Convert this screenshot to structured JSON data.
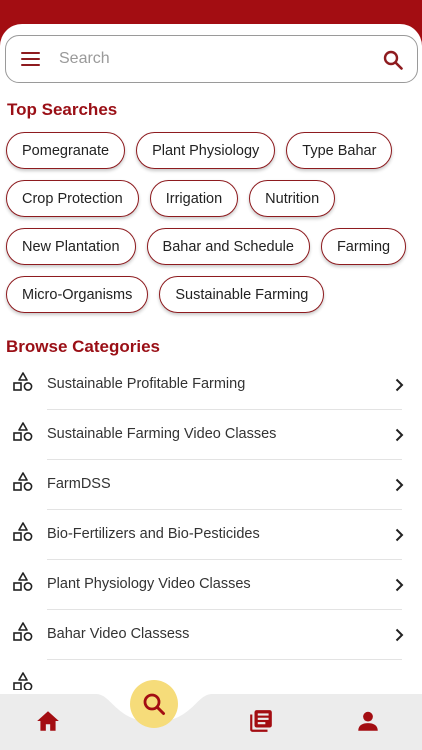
{
  "search": {
    "placeholder": "Search"
  },
  "top_searches": {
    "title": "Top Searches",
    "rows": [
      [
        "Pomegranate",
        "Plant Physiology",
        "Type Bahar"
      ],
      [
        "Crop Protection",
        "Irrigation",
        "Nutrition"
      ],
      [
        "New Plantation",
        "Bahar and Schedule",
        "Farming"
      ],
      [
        "Micro-Organisms",
        "Sustainable Farming"
      ]
    ]
  },
  "browse": {
    "title": "Browse Categories",
    "items": [
      "Sustainable Profitable Farming",
      "Sustainable Farming Video Classes",
      "FarmDSS",
      "Bio-Fertilizers and Bio-Pesticides",
      "Plant Physiology Video Classes",
      "Bahar Video Classess"
    ]
  },
  "bottom_nav": {
    "items": [
      "home-icon",
      "search-icon",
      "library-icon",
      "profile-icon"
    ],
    "active": "search-icon"
  },
  "colors": {
    "brand": "#a30d12",
    "accent_text": "#9a0f16",
    "fab": "#f6dc7a",
    "nav_bg": "#ececec"
  }
}
